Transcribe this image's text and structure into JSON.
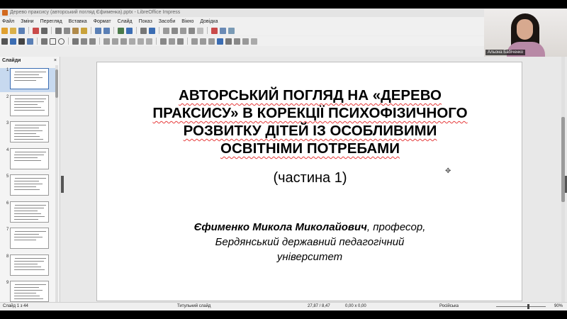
{
  "window": {
    "title": "Дерево праксису (авторський погляд Єфименка).pptx - LibreOffice Impress"
  },
  "menu": [
    "Файл",
    "Зміни",
    "Перегляд",
    "Вставка",
    "Формат",
    "Слайд",
    "Показ",
    "Засоби",
    "Вікно",
    "Довідка"
  ],
  "video": {
    "participant_name": "Альона Бабіченко"
  },
  "slides_pane": {
    "header": "Слайди",
    "close_label": "×",
    "thumbnails": [
      {
        "number": "1",
        "selected": true
      },
      {
        "number": "2",
        "selected": false
      },
      {
        "number": "3",
        "selected": false
      },
      {
        "number": "4",
        "selected": false
      },
      {
        "number": "5",
        "selected": false
      },
      {
        "number": "6",
        "selected": false
      },
      {
        "number": "7",
        "selected": false
      },
      {
        "number": "8",
        "selected": false
      },
      {
        "number": "9",
        "selected": false
      }
    ]
  },
  "slide": {
    "title_lines": [
      "АВТОРСЬКИЙ  ПОГЛЯД  НА  «ДЕРЕВО",
      "ПРАКСИСУ» В  КОРЕКЦІЇ  ПСИХОФІЗИЧНОГО",
      "РОЗВИТКУ  ДІТЕЙ  ІЗ  ОСОБЛИВИМИ",
      "ОСВІТНІМИ  ПОТРЕБАМИ"
    ],
    "subtitle": "(частина 1)",
    "author_name": "Єфименко Микола Миколайович",
    "author_role": ", професор,",
    "affiliation_line1": "Бердянський державний педагогічний",
    "affiliation_line2": "університет"
  },
  "status": {
    "slide_counter": "Слайд 1 з 44",
    "layout": "Титульний слайд",
    "position": "27,87 / 8,47",
    "size": "0,00 x 0,00",
    "language": "Російська",
    "zoom": "90%"
  }
}
